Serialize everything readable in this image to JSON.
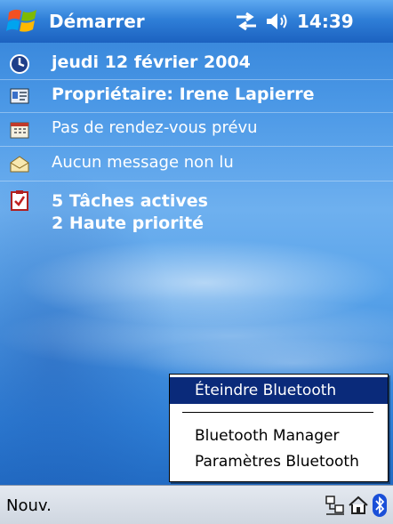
{
  "titlebar": {
    "start_label": "Démarrer",
    "time": "14:39"
  },
  "today": {
    "date": "jeudi 12 février 2004",
    "owner": "Propriétaire: Irene Lapierre",
    "calendar": "Pas de rendez-vous prévu",
    "inbox": "Aucun message non lu",
    "tasks_active": "5 Tâches actives",
    "tasks_priority": "2 Haute priorité"
  },
  "bt_menu": {
    "turn_off": "Éteindre Bluetooth",
    "manager": "Bluetooth Manager",
    "settings": "Paramètres Bluetooth",
    "selected": "turn_off"
  },
  "bottombar": {
    "new_label": "Nouv."
  },
  "icons": {
    "start": "windows-flag-icon",
    "sync": "sync-arrows-icon",
    "speaker": "speaker-icon",
    "date": "clock-icon",
    "owner": "contact-card-icon",
    "calendar": "calendar-icon",
    "inbox": "envelope-icon",
    "tasks": "clipboard-check-icon",
    "tray_network": "network-icon",
    "tray_home": "home-icon",
    "tray_bluetooth": "bluetooth-icon"
  },
  "colors": {
    "titlebar": "#2f7fd8",
    "menu_highlight": "#0a2a7a",
    "bottombar": "#d8dee7",
    "bluetooth": "#1a4fd8"
  }
}
